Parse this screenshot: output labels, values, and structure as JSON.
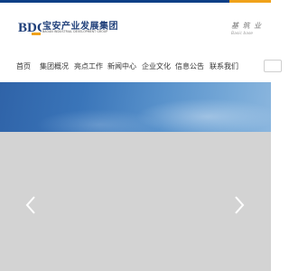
{
  "brand": {
    "logo_mark": "BDG",
    "name_cn": "宝安产业发展集团",
    "name_en": "BAOAN INDUSTRIAL DEVELOPMENT GROUP",
    "primary_color": "#1f3f7a",
    "accent_color": "#f0a21a"
  },
  "slogan": {
    "cn": "基 筑 业",
    "en": "Basic base"
  },
  "nav": {
    "items": [
      {
        "label": "首页"
      },
      {
        "label": "集团概况"
      },
      {
        "label": "亮点工作"
      },
      {
        "label": "新闻中心"
      },
      {
        "label": "企业文化"
      },
      {
        "label": "信息公告"
      },
      {
        "label": "联系我们"
      }
    ]
  },
  "slider": {
    "prev_icon": "chevron-left-icon",
    "next_icon": "chevron-right-icon"
  }
}
